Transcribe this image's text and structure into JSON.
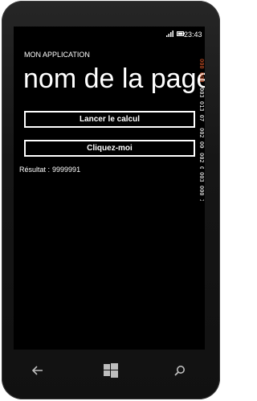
{
  "status_bar": {
    "time": "23:43",
    "icons": [
      "signal-icon",
      "battery-icon"
    ]
  },
  "app": {
    "app_title": "MON APPLICATION",
    "page_title": "nom de la page"
  },
  "buttons": {
    "launch_calc": "Lancer le calcul",
    "click_me": "Cliquez-moi"
  },
  "result": {
    "label": "Résultat :",
    "value": "9999991"
  },
  "perf_counters": [
    "000 000",
    "003 013 07",
    "002 000",
    "002 000",
    "003 000 3557"
  ],
  "nav_bar": {
    "icons": [
      "back-arrow-icon",
      "windows-start-icon",
      "search-icon"
    ]
  },
  "colors": {
    "background": "#000000",
    "foreground": "#ffffff",
    "counter_accent": "#e05a2a",
    "phone_body": "#1a1a1a"
  }
}
